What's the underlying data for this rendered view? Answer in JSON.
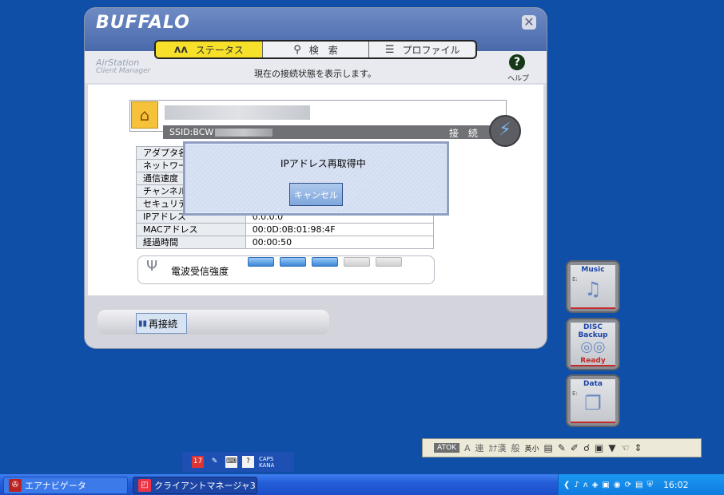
{
  "window": {
    "brand": "BUFFALO",
    "close_glyph": "✕",
    "tabs": [
      {
        "label": "ステータス",
        "icon": "pulse-icon",
        "glyph": "ᴧᴧ",
        "active": true
      },
      {
        "label": "検　索",
        "icon": "search-icon",
        "glyph": "⚲",
        "active": false
      },
      {
        "label": "プロファイル",
        "icon": "profile-icon",
        "glyph": "☰",
        "active": false
      }
    ],
    "airstation_line1": "AirStation",
    "airstation_line2": "Client Manager",
    "subtitle": "現在の接続状態を表示します。",
    "help_glyph": "?",
    "help_label": "ヘルプ"
  },
  "network": {
    "ssid_prefix": "SSID:BCW",
    "status": "接 続",
    "home_glyph": "⌂",
    "conn_glyph": "⚡"
  },
  "info_rows": [
    {
      "key": "アダプタ名",
      "value": ""
    },
    {
      "key": "ネットワーク",
      "value": ""
    },
    {
      "key": "通信速度",
      "value": ""
    },
    {
      "key": "チャンネル",
      "value": ""
    },
    {
      "key": "セキュリティ",
      "value": ""
    },
    {
      "key": "IPアドレス",
      "value": "0.0.0.0"
    },
    {
      "key": "MACアドレス",
      "value": "00:0D:0B:01:98:4F"
    },
    {
      "key": "経過時間",
      "value": "00:00:50"
    }
  ],
  "signal": {
    "label": "電波受信強度",
    "antenna_glyph": "Ψ",
    "level": 3,
    "max": 5
  },
  "dialog": {
    "message": "IPアドレス再取得中",
    "cancel_label": "キャンセル"
  },
  "reconnect": {
    "label": "再接続",
    "glyph": "▮▮"
  },
  "gadgets": [
    {
      "title": "Music",
      "glyph": "♫",
      "status": ""
    },
    {
      "title": "DISC Backup",
      "glyph": "◎◎",
      "status": "Ready"
    },
    {
      "title": "Data",
      "glyph": "❐",
      "status": ""
    }
  ],
  "ime": {
    "atok": "ATOK",
    "items": [
      "A",
      "連",
      "ｶﾅ漢",
      "般",
      "英小"
    ]
  },
  "smalltool": {
    "caps": "CAPS",
    "kana": "KANA",
    "cal": "17"
  },
  "taskbar": {
    "tasks": [
      {
        "label": "エアナビゲータ",
        "icon": "airnavi-icon"
      },
      {
        "label": "クライアントマネージャ3",
        "icon": "client-manager-icon"
      }
    ],
    "clock": "16:02"
  },
  "colors": {
    "desktop": "#0f4fa8",
    "tab_active": "#f6e02a",
    "signal_on": "#3b86d8",
    "gadget_accent": "#c42a2a"
  }
}
